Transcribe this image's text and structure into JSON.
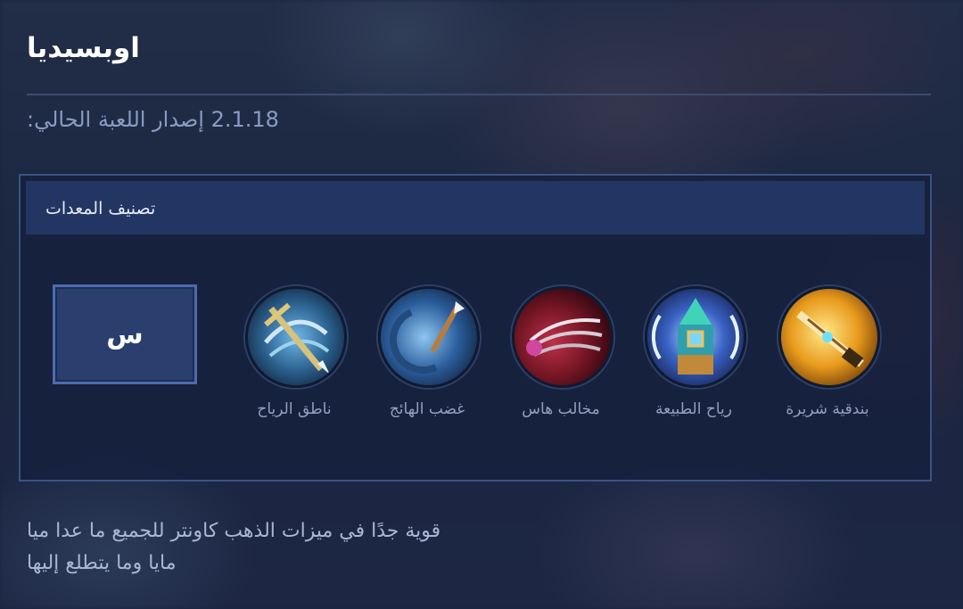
{
  "page": {
    "title": "اوبسيديا",
    "version_text": "2.1.18 إصدار اللعبة الحالي:"
  },
  "equipment": {
    "header": "تصنيف المعدات",
    "tier_label": "س",
    "items": [
      {
        "name": "ناطق الرياح",
        "icon": "wind-talker-icon"
      },
      {
        "name": "غضب الهائج",
        "icon": "berserkers-fury-icon"
      },
      {
        "name": "مخالب هاس",
        "icon": "haas-claws-icon"
      },
      {
        "name": "رياح الطبيعة",
        "icon": "wind-of-nature-icon"
      },
      {
        "name": "بندقية شريرة",
        "icon": "demon-hunter-rifle-icon"
      }
    ]
  },
  "description": {
    "line1": "قوية جدًا في ميزات الذهب كاونتر للجميع ما عدا ميا",
    "line2": "مايا وما يتطلع إليها"
  },
  "colors": {
    "accent": "#4c6bb0",
    "panel_header": "#233562",
    "text_muted": "#93a0bd"
  }
}
